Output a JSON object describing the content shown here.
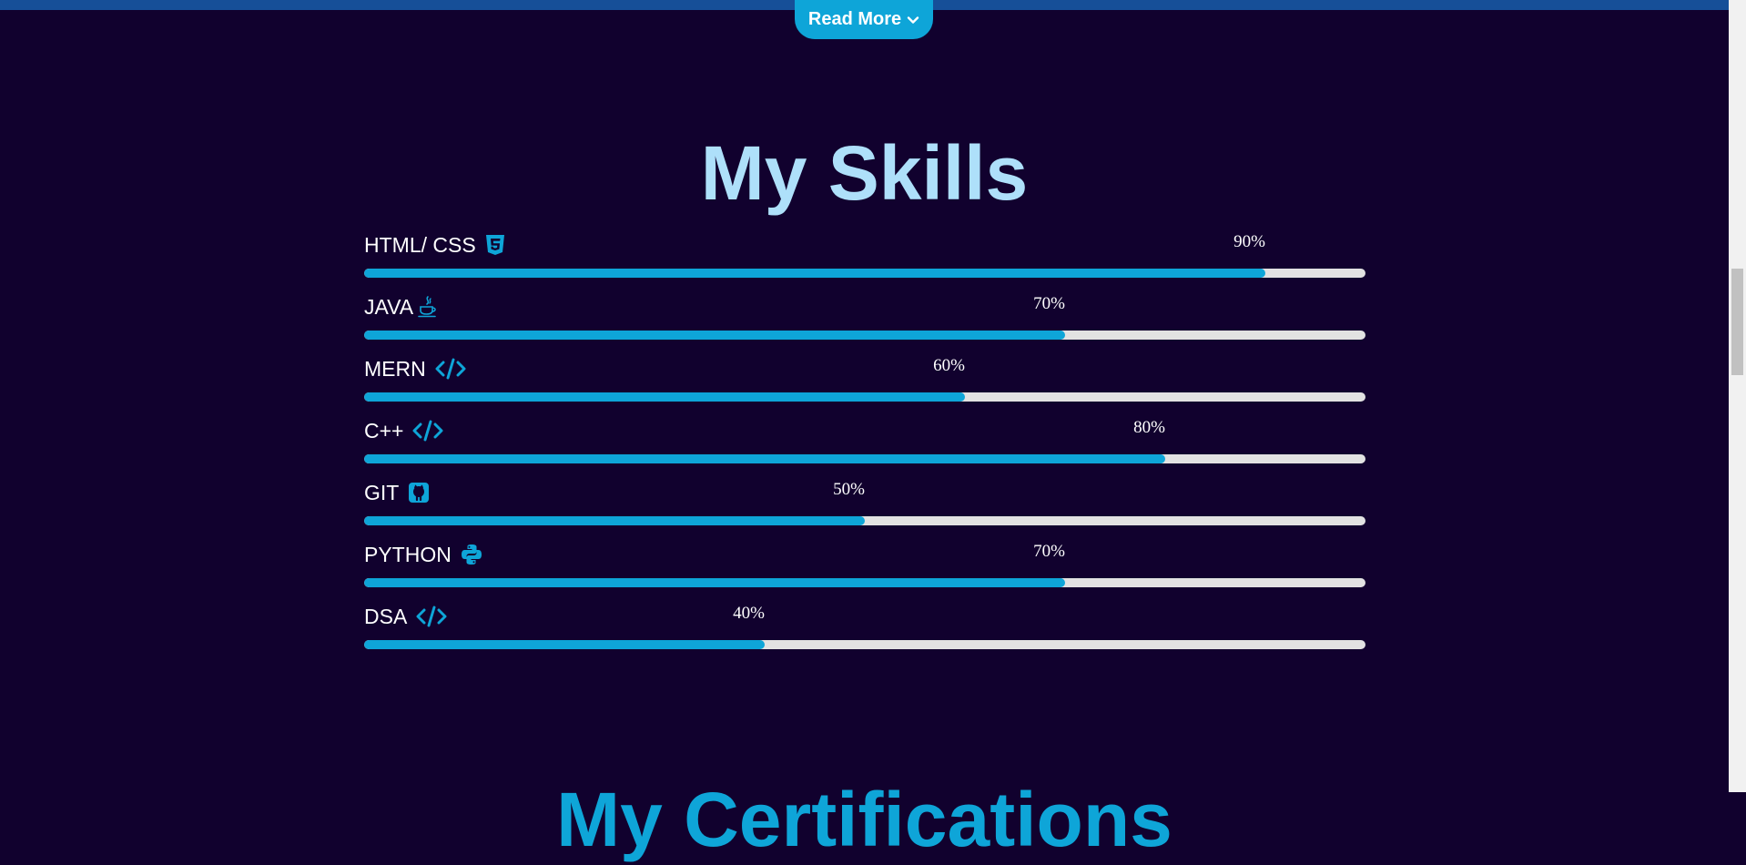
{
  "header": {
    "read_more_label": "Read More"
  },
  "skills_section": {
    "title": "My Skills",
    "skills": [
      {
        "name": "HTML/ CSS",
        "icon": "html5-icon",
        "percent_label": "90%",
        "level": 0.9
      },
      {
        "name": "JAVA",
        "icon": "java-icon",
        "percent_label": "70%",
        "level": 0.7
      },
      {
        "name": "MERN",
        "icon": "code-icon",
        "percent_label": "60%",
        "level": 0.6
      },
      {
        "name": "C++",
        "icon": "code-icon",
        "percent_label": "80%",
        "level": 0.8
      },
      {
        "name": "GIT",
        "icon": "github-icon",
        "percent_label": "50%",
        "level": 0.5
      },
      {
        "name": "PYTHON",
        "icon": "python-icon",
        "percent_label": "70%",
        "level": 0.7
      },
      {
        "name": "DSA",
        "icon": "code-icon",
        "percent_label": "40%",
        "level": 0.4
      }
    ]
  },
  "next_section": {
    "title_partial": "My Certifications"
  },
  "colors": {
    "background": "#11012e",
    "accent": "#0ea5d8",
    "title": "#aee0fa",
    "track": "#e2e2e2",
    "top_bar": "#164f98"
  }
}
